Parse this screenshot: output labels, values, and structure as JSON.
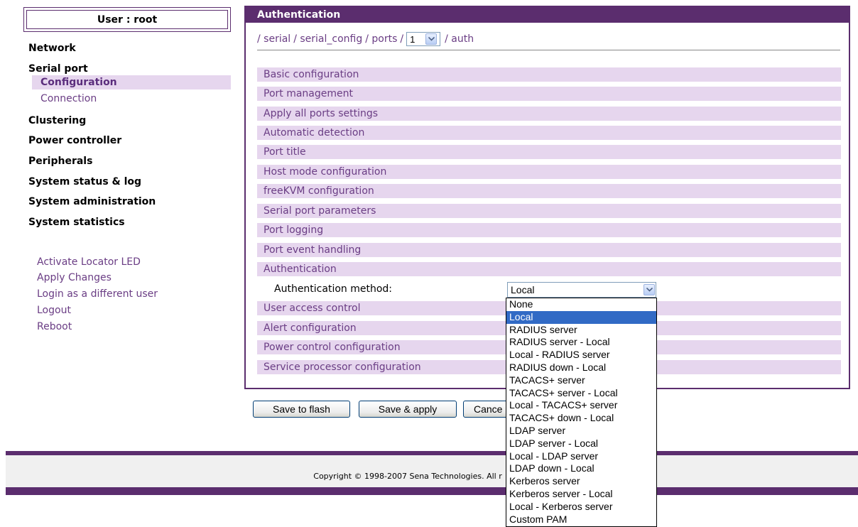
{
  "sidebar": {
    "user_label": "User : root",
    "nav": [
      "Network",
      "Serial port",
      "Clustering",
      "Power controller",
      "Peripherals",
      "System status & log",
      "System administration",
      "System statistics"
    ],
    "serial_sub": [
      "Configuration",
      "Connection"
    ],
    "utility": [
      "Activate Locator LED",
      "Apply Changes",
      "Login as a different user",
      "Logout",
      "Reboot"
    ]
  },
  "panel": {
    "title": "Authentication",
    "breadcrumb": {
      "before": [
        "/ serial",
        "/ serial_config",
        "/ ports",
        "/"
      ],
      "port": "1",
      "after": "/ auth"
    },
    "sections": [
      "Basic configuration",
      "Port management",
      "Apply all ports settings",
      "Automatic detection",
      "Port title",
      "Host mode configuration",
      "freeKVM configuration",
      "Serial port parameters",
      "Port logging",
      "Port event handling",
      "Authentication",
      "User access control",
      "Alert configuration",
      "Power control configuration",
      "Service processor configuration"
    ],
    "auth_method_label": "Authentication method:",
    "auth_method_value": "Local"
  },
  "buttons": {
    "save_flash": "Save to flash",
    "save_apply": "Save & apply",
    "cancel": "Cance"
  },
  "footer": {
    "copyright": "Copyright © 1998-2007 Sena Technologies. All r"
  },
  "dropdown": {
    "options": [
      "None",
      "Local",
      "RADIUS server",
      "RADIUS server - Local",
      "Local - RADIUS server",
      "RADIUS down - Local",
      "TACACS+ server",
      "TACACS+ server - Local",
      "Local - TACACS+ server",
      "TACACS+ down - Local",
      "LDAP server",
      "LDAP server - Local",
      "Local - LDAP server",
      "LDAP down - Local",
      "Kerberos server",
      "Kerberos server - Local",
      "Local - Kerberos server",
      "Custom PAM"
    ],
    "selected": "Local"
  },
  "colors": {
    "brand": "#5b2d6e",
    "section_bg": "#e6d6ee",
    "link": "#6a3d84",
    "selection": "#316ac5"
  }
}
